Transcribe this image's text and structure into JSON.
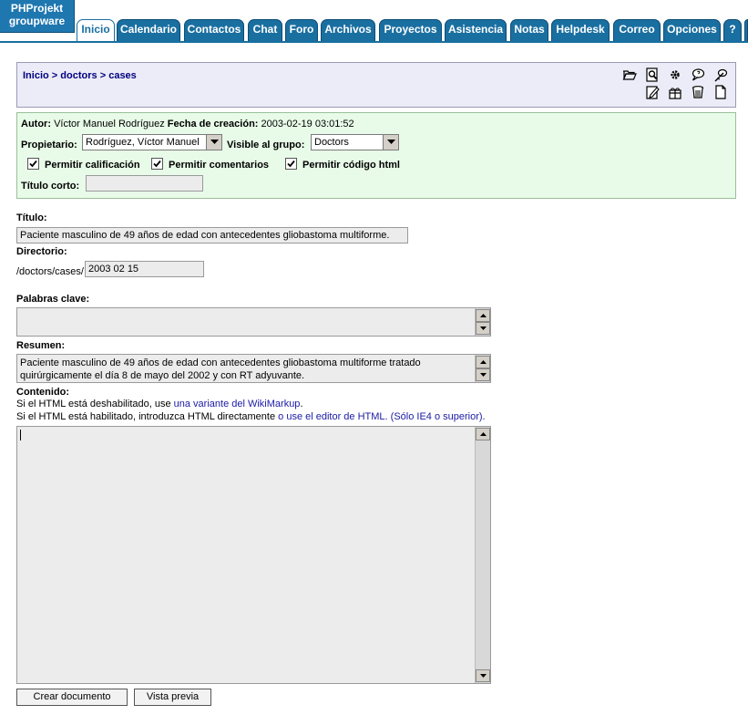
{
  "app": {
    "logo_line1": "PHProjekt",
    "logo_line2": "groupware"
  },
  "tabs": [
    {
      "label": "Inicio",
      "active": true
    },
    {
      "label": "Calendario"
    },
    {
      "label": "Contactos"
    },
    {
      "label": "Chat"
    },
    {
      "label": "Foro"
    },
    {
      "label": "Archivos"
    },
    {
      "label": "Proyectos"
    },
    {
      "label": "Asistencia"
    },
    {
      "label": "Notas"
    },
    {
      "label": "Helpdesk"
    },
    {
      "label": "Correo"
    },
    {
      "label": "Opciones"
    },
    {
      "label": "?"
    }
  ],
  "breadcrumb": {
    "home": "Inicio",
    "sep": ">",
    "level1": "doctors",
    "level2": "cases"
  },
  "toolbar_icons": [
    "folder-open-icon",
    "search-document-icon",
    "gear-icon",
    "speech-bubble-icon",
    "feather-icon",
    "edit-icon",
    "gift-icon",
    "trash-icon",
    "blank-document-icon"
  ],
  "meta": {
    "author_label": "Autor:",
    "author_value": "Víctor Manuel Rodríguez",
    "created_label": "Fecha de creación:",
    "created_value": "2003-02-19 03:01:52",
    "owner_label": "Propietario:",
    "owner_value": "Rodríguez, Víctor Manuel",
    "group_label": "Visible al grupo:",
    "group_value": "Doctors",
    "allow_rating": "Permitir calificación",
    "allow_comments": "Permitir comentarios",
    "allow_html": "Permitir código html",
    "short_title_label": "Título corto:",
    "short_title_value": ""
  },
  "form": {
    "title_label": "Título:",
    "title_value": "Paciente masculino de 49 años de edad con antecedentes gliobastoma multiforme.",
    "dir_label": "Directorio:",
    "dir_prefix": "/doctors/cases/",
    "dir_value": "2003 02 15",
    "keywords_label": "Palabras clave:",
    "keywords_value": "",
    "summary_label": "Resumen:",
    "summary_value": "Paciente masculino de 49 años de edad con antecedentes gliobastoma multiforme tratado quirúrgicamente el día 8 de mayo del 2002 y con RT adyuvante.",
    "content_label": "Contenido:",
    "content_hint1_pre": "Si el HTML está deshabilitado, use ",
    "content_hint1_link": "una variante del WikiMarkup",
    "content_hint1_post": ".",
    "content_hint2_pre": "Si el HTML está habilitado, introduzca HTML directamente ",
    "content_hint2_link": "o use el editor de HTML. (Sólo IE4 o superior)",
    "content_hint2_post": ".",
    "content_value": ""
  },
  "buttons": {
    "create": "Crear documento",
    "preview": "Vista previa"
  }
}
